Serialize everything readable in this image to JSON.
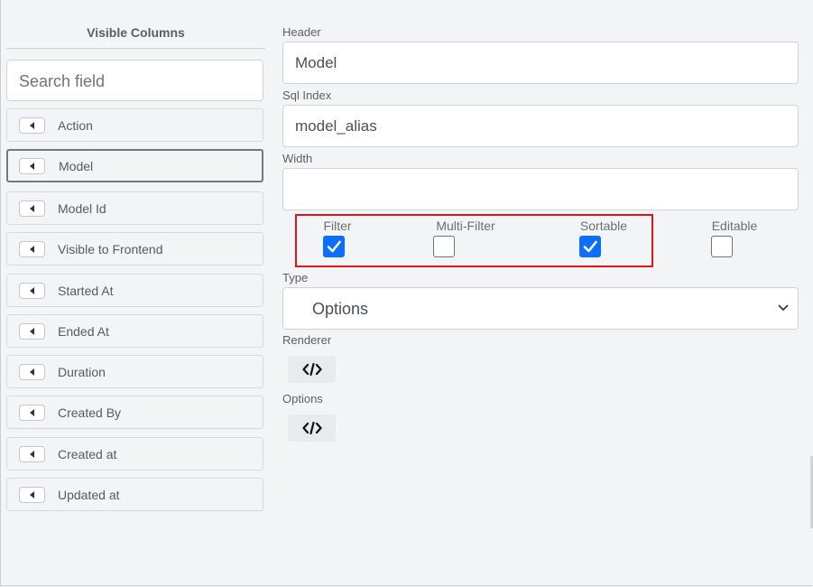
{
  "left_panel": {
    "title": "Visible Columns",
    "search_placeholder": "Search field",
    "columns": [
      {
        "label": "Action",
        "active": false
      },
      {
        "label": "Model",
        "active": true
      },
      {
        "label": "Model Id",
        "active": false
      },
      {
        "label": "Visible to Frontend",
        "active": false
      },
      {
        "label": "Started At",
        "active": false
      },
      {
        "label": "Ended At",
        "active": false
      },
      {
        "label": "Duration",
        "active": false
      },
      {
        "label": "Created By",
        "active": false
      },
      {
        "label": "Created at",
        "active": false
      },
      {
        "label": "Updated at",
        "active": false
      }
    ]
  },
  "form": {
    "header_label": "Header",
    "header_value": "Model",
    "sql_index_label": "Sql Index",
    "sql_index_value": "model_alias",
    "width_label": "Width",
    "width_value": "",
    "checkboxes": [
      {
        "label": "Filter",
        "checked": true
      },
      {
        "label": "Multi-Filter",
        "checked": false
      },
      {
        "label": "Sortable",
        "checked": true
      },
      {
        "label": "Editable",
        "checked": false
      }
    ],
    "type_label": "Type",
    "type_value": "Options",
    "renderer_label": "Renderer",
    "options_label": "Options"
  },
  "colors": {
    "highlight_border": "#e0141f",
    "checkbox_checked": "#0b6efd"
  },
  "icons": {
    "column_move": "caret-left-icon",
    "code": "code-icon",
    "select_chevron": "chevron-down-icon",
    "check": "check-icon"
  }
}
